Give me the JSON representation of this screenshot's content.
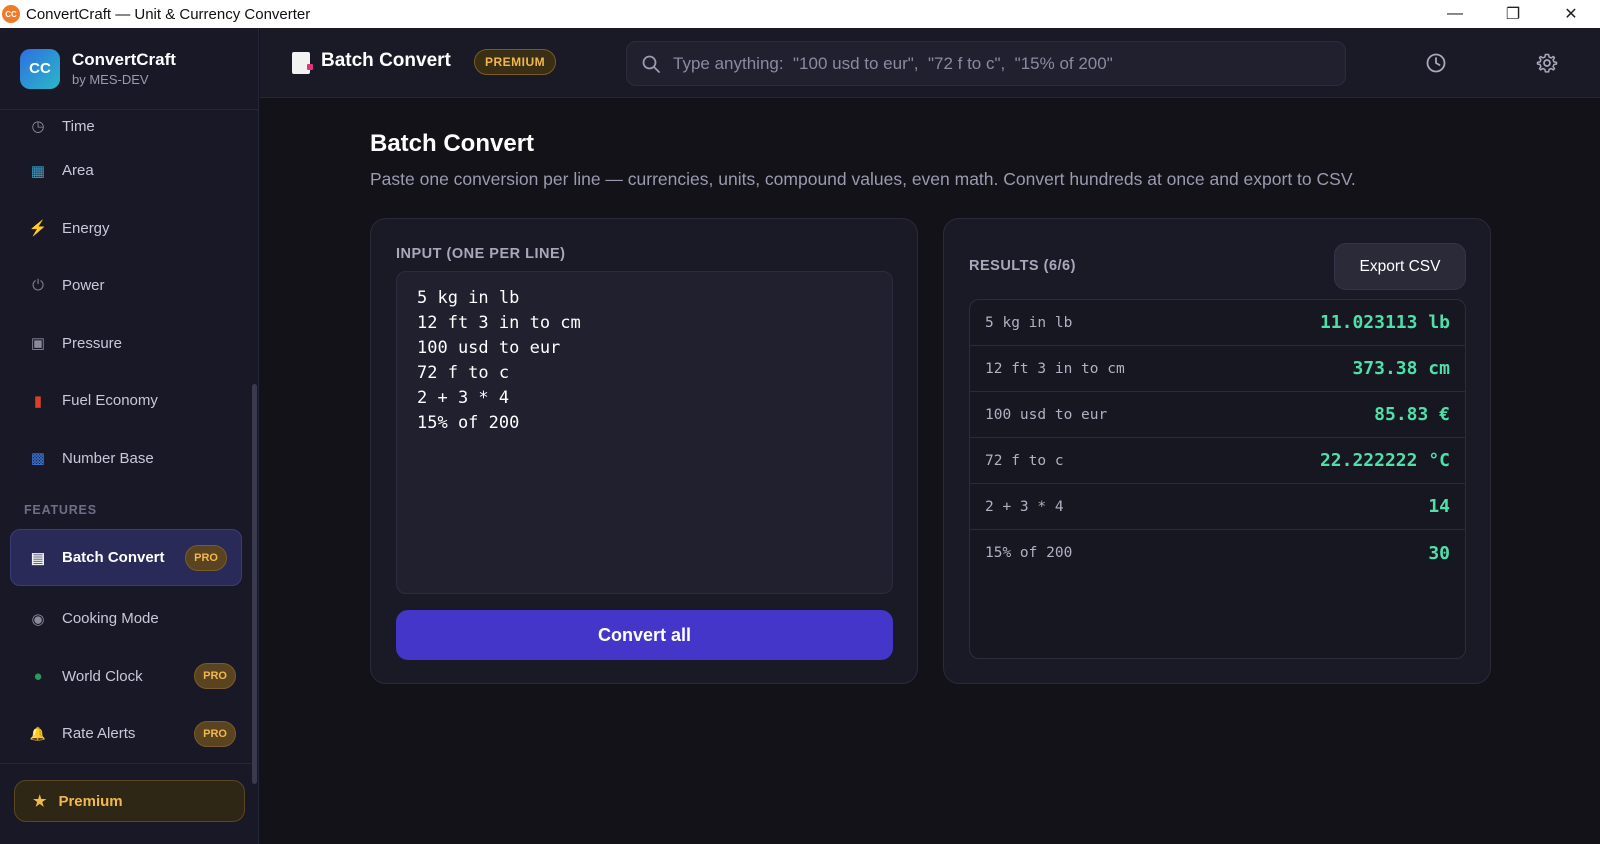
{
  "window": {
    "app_icon_text": "CC",
    "title": "ConvertCraft — Unit & Currency Converter",
    "minimize": "—",
    "restore": "❐",
    "close": "✕"
  },
  "brand": {
    "logo": "CC",
    "name": "ConvertCraft",
    "sub": "by MES-DEV"
  },
  "sidebar": {
    "items": [
      {
        "label": "Time",
        "icon": "clock-icon",
        "glyph": "◷"
      },
      {
        "label": "Area",
        "icon": "map-icon",
        "glyph": "▦"
      },
      {
        "label": "Energy",
        "icon": "lightning-icon",
        "glyph": "⚡"
      },
      {
        "label": "Power",
        "icon": "plug-icon",
        "glyph": "⏻"
      },
      {
        "label": "Pressure",
        "icon": "gauge-icon",
        "glyph": "▣"
      },
      {
        "label": "Fuel Economy",
        "icon": "fuel-pump-icon",
        "glyph": "▮"
      },
      {
        "label": "Number Base",
        "icon": "numbers-icon",
        "glyph": "▩"
      }
    ],
    "features_heading": "FEATURES",
    "features": [
      {
        "label": "Batch Convert",
        "icon": "document-icon",
        "glyph": "▤",
        "badge": "PRO",
        "active": true
      },
      {
        "label": "Cooking Mode",
        "icon": "pan-icon",
        "glyph": "◉",
        "badge": null
      },
      {
        "label": "World Clock",
        "icon": "globe-icon",
        "glyph": "●",
        "badge": "PRO"
      },
      {
        "label": "Rate Alerts",
        "icon": "bell-icon",
        "glyph": "🔔",
        "badge": "PRO"
      }
    ],
    "premium_button": "Premium",
    "premium_star": "★"
  },
  "header": {
    "title": "Batch Convert",
    "tag": "PREMIUM",
    "search_placeholder": "Type anything:  \"100 usd to eur\",  \"72 f to c\",  \"15% of 200\""
  },
  "main": {
    "title": "Batch Convert",
    "subtitle": "Paste one conversion per line — currencies, units, compound values, even math. Convert hundreds at once and export to CSV.",
    "input_label": "INPUT (ONE PER LINE)",
    "input_lines": [
      "5 kg in lb",
      "12 ft 3 in to cm",
      "100 usd to eur",
      "72 f to c",
      "2 + 3 * 4",
      "15% of 200"
    ],
    "convert_button": "Convert all",
    "results_label": "RESULTS (6/6)",
    "export_button": "Export CSV",
    "results": [
      {
        "expr": "5 kg in lb",
        "value": "11.023113 lb"
      },
      {
        "expr": "12 ft 3 in to cm",
        "value": "373.38 cm"
      },
      {
        "expr": "100 usd to eur",
        "value": "85.83 €"
      },
      {
        "expr": "72 f to c",
        "value": "22.222222 °C"
      },
      {
        "expr": "2 + 3 * 4",
        "value": "14"
      },
      {
        "expr": "15% of 200",
        "value": "30"
      }
    ]
  },
  "colors": {
    "accent": "#4336c8",
    "result_value": "#4fe0a8",
    "pro_badge": "#f2b84b"
  }
}
